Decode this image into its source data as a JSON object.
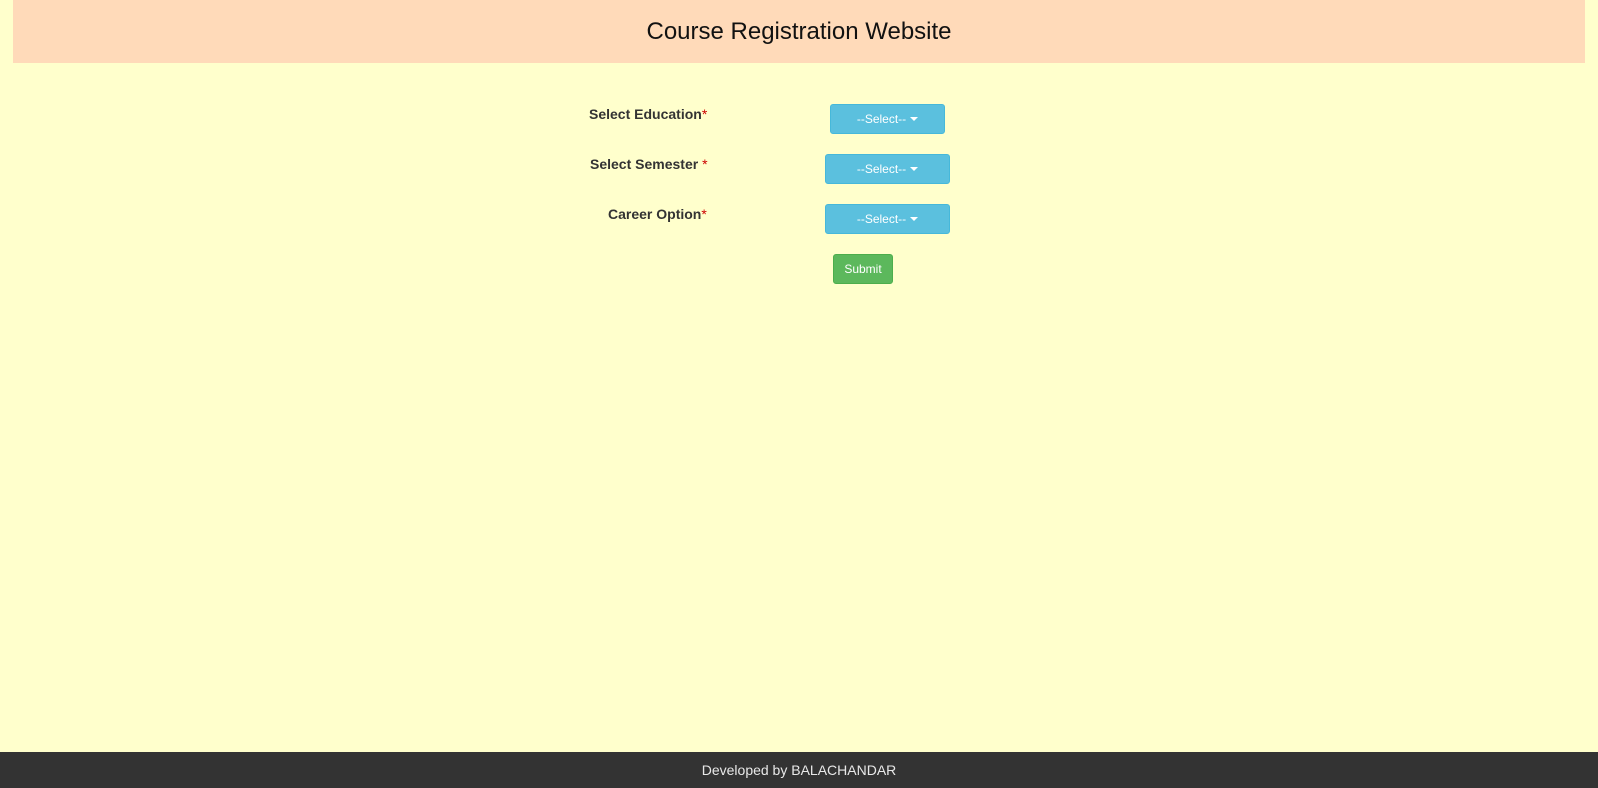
{
  "header": {
    "title": "Course Registration Website"
  },
  "form": {
    "education": {
      "label": "Select Education",
      "required_mark": "*",
      "select_label": "--Select--"
    },
    "semester": {
      "label": "Select Semester ",
      "required_mark": "*",
      "select_label": "--Select--"
    },
    "career": {
      "label": "Career Option",
      "required_mark": "*",
      "select_label": "--Select--"
    },
    "submit_label": "Submit"
  },
  "footer": {
    "text": "Developed by BALACHANDAR"
  },
  "colors": {
    "page_background": "#ffffcc",
    "header_background": "#ffdab9",
    "select_button": "#5bc0de",
    "submit_button": "#5cb85c",
    "footer_background": "#333333",
    "required_mark": "#cc0000"
  }
}
